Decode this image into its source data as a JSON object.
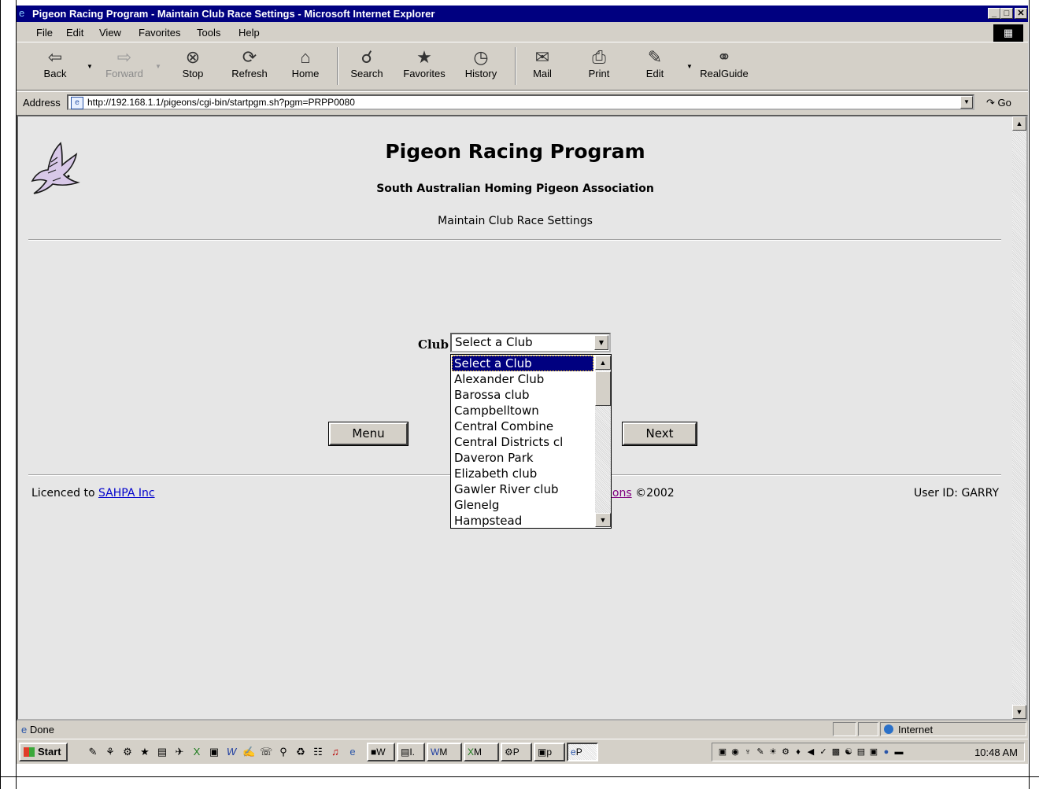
{
  "window": {
    "title": "Pigeon Racing Program - Maintain Club Race Settings - Microsoft Internet Explorer",
    "controls": [
      "_",
      "□",
      "✕"
    ]
  },
  "menubar": {
    "items": [
      "File",
      "Edit",
      "View",
      "Favorites",
      "Tools",
      "Help"
    ]
  },
  "toolbar": {
    "back": "Back",
    "forward": "Forward",
    "stop": "Stop",
    "refresh": "Refresh",
    "home": "Home",
    "search": "Search",
    "favorites": "Favorites",
    "history": "History",
    "mail": "Mail",
    "print": "Print",
    "edit": "Edit",
    "realguide": "RealGuide"
  },
  "address": {
    "label": "Address",
    "url": "http://192.168.1.1/pigeons/cgi-bin/startpgm.sh?pgm=PRPP0080",
    "go": "Go"
  },
  "page": {
    "title": "Pigeon Racing Program",
    "subtitle": "South Australian Homing Pigeon Association",
    "section": "Maintain Club Race Settings",
    "club_label": "Club",
    "club_selected": "Select a Club",
    "club_options": [
      "Select a Club",
      "Alexander Club",
      "Barossa club",
      "Campbelltown",
      "Central Combine",
      "Central Districts cl",
      "Daveron Park",
      "Elizabeth club",
      "Gawler River club",
      "Glenelg",
      "Hampstead"
    ],
    "menu_button": "Menu",
    "next_button": "Next",
    "licence_prefix": "Licenced to ",
    "licence_link": "SAHPA Inc",
    "copyright_link": "ions",
    "copyright_suffix": " ©2002",
    "user_id": "User ID: GARRY"
  },
  "statusbar": {
    "status": "Done",
    "zone": "Internet"
  },
  "taskbar": {
    "start": "Start",
    "tasks": [
      "W",
      "I.",
      "M",
      "M",
      "P",
      "p",
      "P"
    ],
    "clock": "10:48 AM"
  },
  "colors": {
    "titlebar": "#000080",
    "chrome": "#d4d0c8",
    "page_background": "#e6e6e6",
    "selection": "#000080"
  }
}
